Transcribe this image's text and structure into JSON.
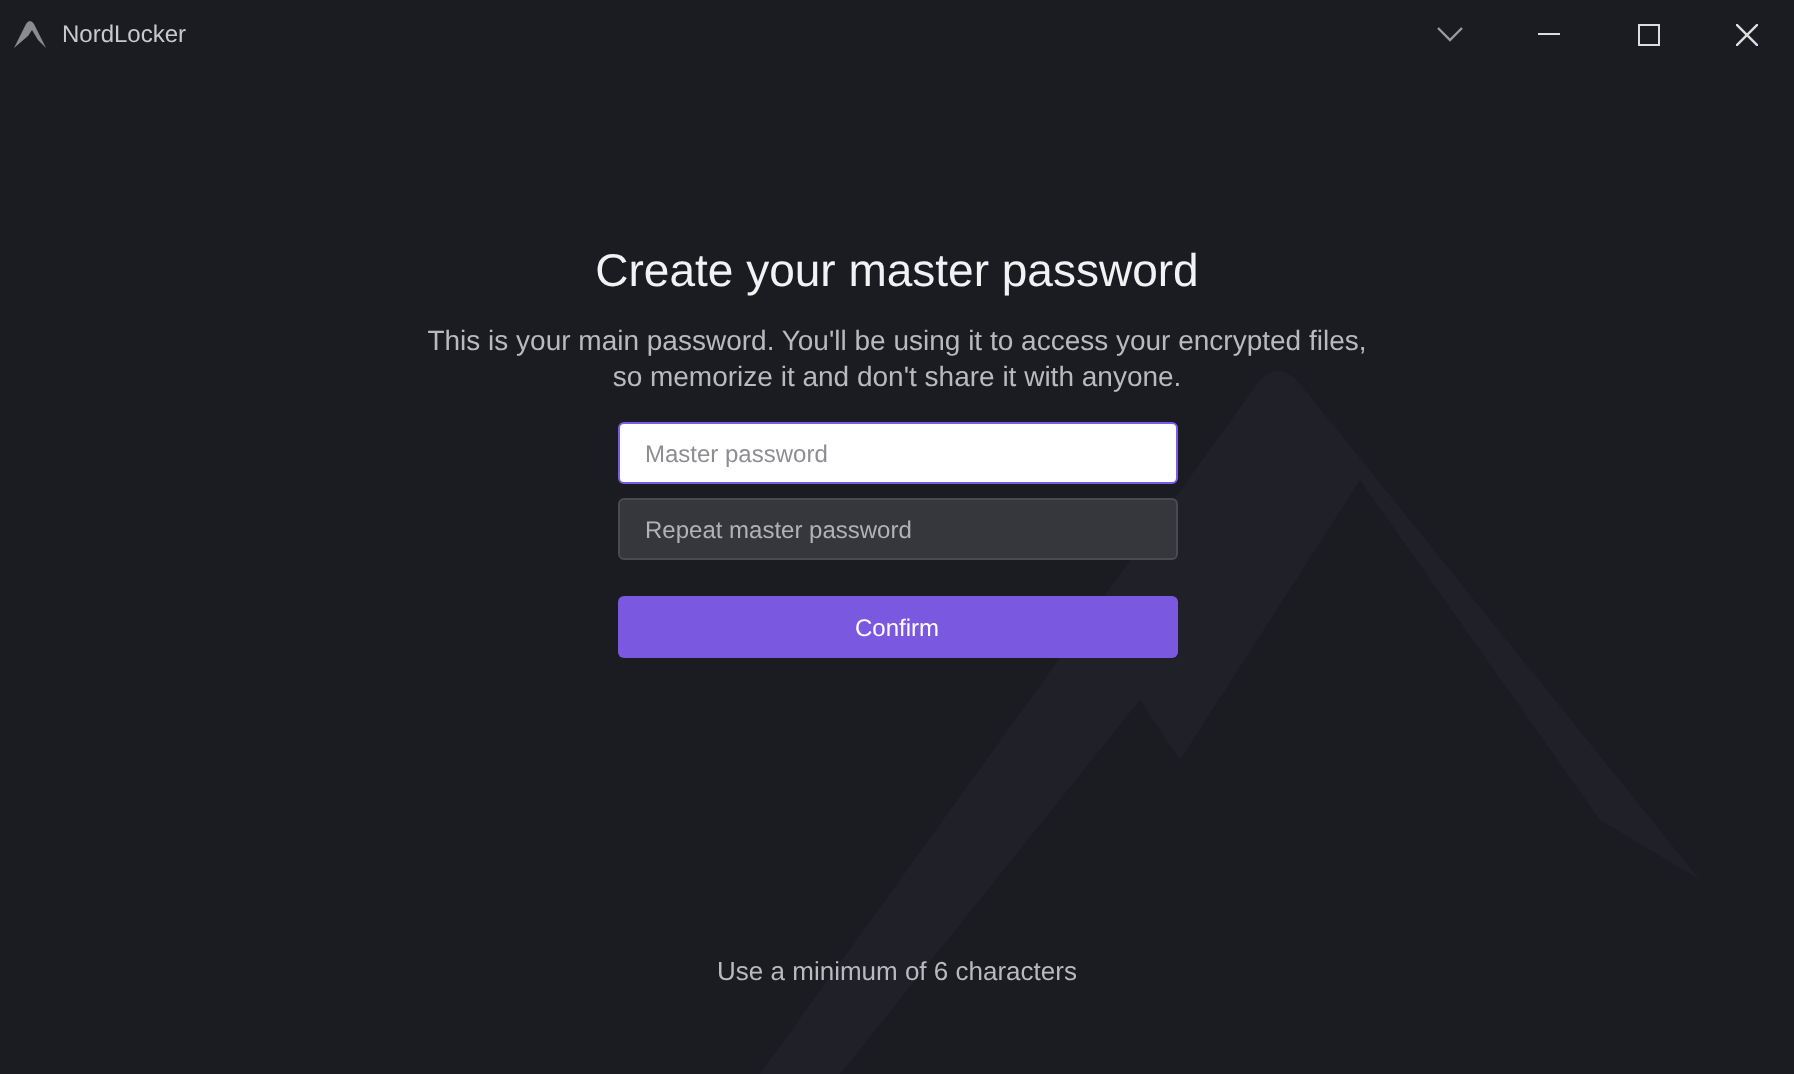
{
  "window": {
    "title": "NordLocker"
  },
  "heading": "Create your master password",
  "description": "This is your main password. You'll be using it to access your encrypted files, so memorize it and don't share it with anyone.",
  "fields": [
    {
      "placeholder": "Master password",
      "focused": true
    },
    {
      "placeholder": "Repeat master password",
      "focused": false
    }
  ],
  "confirm_button": "Confirm",
  "hint": "Use a minimum of 6 characters"
}
